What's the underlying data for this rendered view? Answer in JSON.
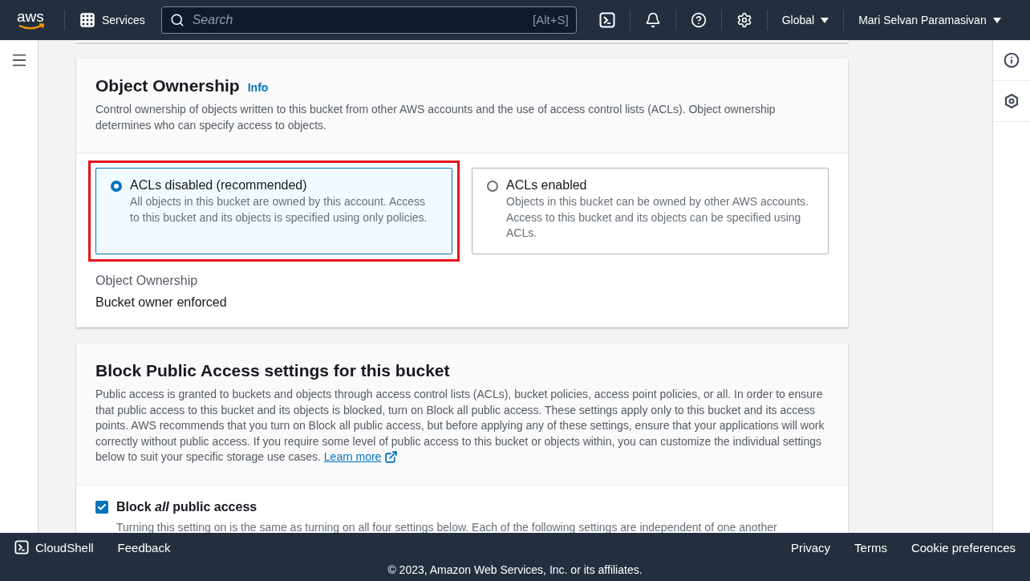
{
  "top_nav": {
    "logo": "aws",
    "services": "Services",
    "search": {
      "placeholder": "Search",
      "shortcut": "[Alt+S]"
    },
    "region": "Global",
    "user": "Mari Selvan Paramasivan"
  },
  "object_ownership": {
    "title": "Object Ownership",
    "info": "Info",
    "description": "Control ownership of objects written to this bucket from other AWS accounts and the use of access control lists (ACLs). Object ownership determines who can specify access to objects.",
    "options": [
      {
        "label": "ACLs disabled (recommended)",
        "description": "All objects in this bucket are owned by this account. Access to this bucket and its objects is specified using only policies.",
        "selected": true,
        "highlighted": true
      },
      {
        "label": "ACLs enabled",
        "description": "Objects in this bucket can be owned by other AWS accounts. Access to this bucket and its objects can be specified using ACLs.",
        "selected": false,
        "highlighted": false
      }
    ],
    "field_label": "Object Ownership",
    "field_value": "Bucket owner enforced"
  },
  "block_public_access": {
    "title": "Block Public Access settings for this bucket",
    "description": "Public access is granted to buckets and objects through access control lists (ACLs), bucket policies, access point policies, or all. In order to ensure that public access to this bucket and its objects is blocked, turn on Block all public access. These settings apply only to this bucket and its access points. AWS recommends that you turn on Block all public access, but before applying any of these settings, ensure that your applications will work correctly without public access. If you require some level of public access to this bucket or objects within, you can customize the individual settings below to suit your specific storage use cases.",
    "learn_more": "Learn more",
    "checkbox": {
      "label": "Block *all* public access",
      "checked": true,
      "description": "Turning this setting on is the same as turning on all four settings below. Each of the following settings are independent of one another"
    }
  },
  "footer": {
    "cloudshell": "CloudShell",
    "feedback": "Feedback",
    "links": [
      "Privacy",
      "Terms",
      "Cookie preferences"
    ],
    "copyright": "© 2023, Amazon Web Services, Inc. or its affiliates."
  }
}
